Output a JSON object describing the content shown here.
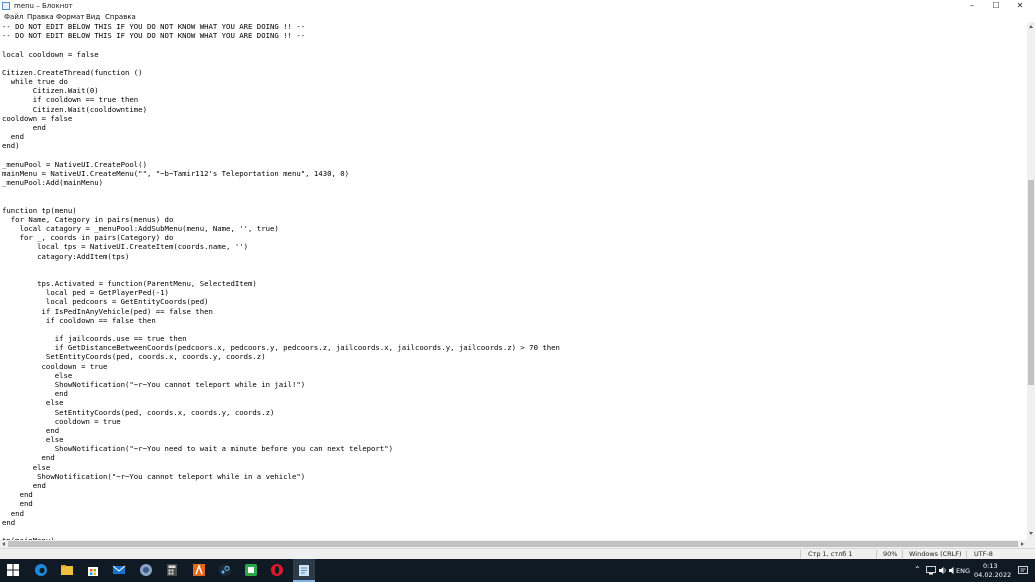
{
  "window": {
    "title": "menu – Блокнот",
    "controls": [
      "–",
      "☐",
      "✕"
    ]
  },
  "menubar": {
    "items": [
      "Файл",
      "Правка",
      "Формат",
      "Вид",
      "Справка"
    ]
  },
  "editor": {
    "lines": [
      "-- DO NOT EDIT BELOW THIS IF YOU DO NOT KNOW WHAT YOU ARE DOING !! --",
      "-- DO NOT EDIT BELOW THIS IF YOU DO NOT KNOW WHAT YOU ARE DOING !! --",
      "",
      "local cooldown = false",
      "",
      "Citizen.CreateThread(function ()",
      "  while true do",
      "       Citizen.Wait(0)",
      "       if cooldown == true then",
      "       Citizen.Wait(cooldowntime)",
      "cooldown = false",
      "       end",
      "  end",
      "end)",
      "",
      "_menuPool = NativeUI.CreatePool()",
      "mainMenu = NativeUI.CreateMenu(\"\", \"~b~Tamir112's Teleportation menu\", 1430, 0)",
      "_menuPool:Add(mainMenu)",
      "",
      "",
      "function tp(menu)",
      "  for Name, Category in pairs(menus) do",
      "    local catagory = _menuPool:AddSubMenu(menu, Name, '', true)",
      "    for _, coords in pairs(Category) do",
      "        local tps = NativeUI.CreateItem(coords.name, '')",
      "        catagory:AddItem(tps)",
      "",
      "",
      "        tps.Activated = function(ParentMenu, SelectedItem)",
      "          local ped = GetPlayerPed(-1)",
      "          local pedcoors = GetEntityCoords(ped)",
      "         if IsPedInAnyVehicle(ped) == false then",
      "          if cooldown == false then",
      "",
      "            if jailcoords.use == true then",
      "            if GetDistanceBetweenCoords(pedcoors.x, pedcoors.y, pedcoors.z, jailcoords.x, jailcoords.y, jailcoords.z) > 70 then",
      "          SetEntityCoords(ped, coords.x, coords.y, coords.z)",
      "         cooldown = true",
      "            else",
      "            ShowNotification(\"~r~You cannot teleport while in jail!\")",
      "            end",
      "          else",
      "            SetEntityCoords(ped, coords.x, coords.y, coords.z)",
      "            cooldown = true",
      "          end",
      "          else",
      "            ShowNotification(\"~r~You need to wait a minute before you can next teleport\")",
      "         end",
      "       else",
      "        ShowNotification(\"~r~You cannot teleport while in a vehicle\")",
      "       end",
      "    end",
      "    end",
      "  end",
      "end",
      "",
      "tp(mainMenu)"
    ]
  },
  "statusbar": {
    "position": "Стр 1, стлб 1",
    "zoom": "90%",
    "line_endings": "Windows (CRLF)",
    "encoding": "UTF-8"
  },
  "taskbar": {
    "apps": [
      "start",
      "search",
      "edge",
      "file-explorer",
      "store",
      "mail",
      "steam-like",
      "calculator",
      "vlc-like",
      "steam",
      "opera",
      "notepad"
    ],
    "tray": {
      "language": "ENG",
      "time": "0:13",
      "date": "04.02.2022"
    }
  },
  "colors": {
    "taskbar": "#101a24",
    "accent": "#7fb3e6",
    "editor_bg": "#ffffff"
  }
}
